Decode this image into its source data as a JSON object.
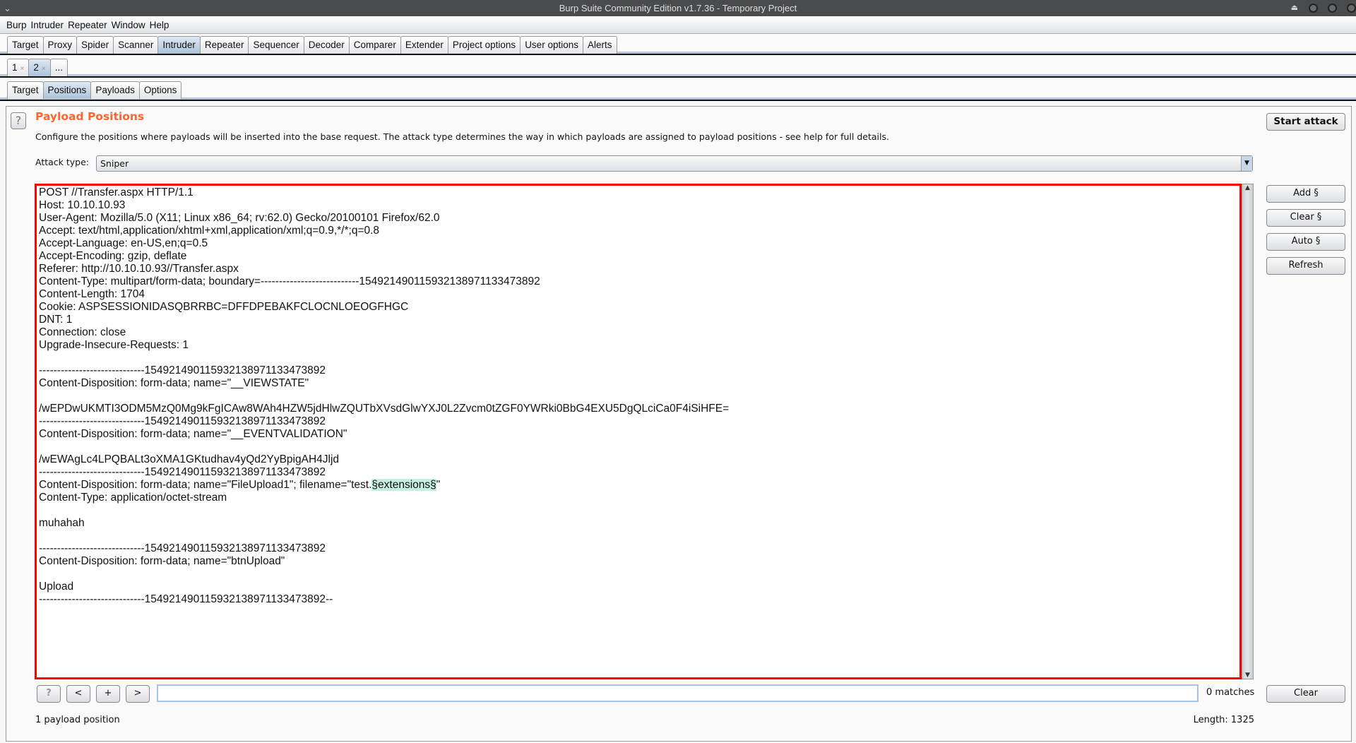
{
  "window": {
    "title": "Burp Suite Community Edition v1.7.36 - Temporary Project"
  },
  "menu": [
    "Burp",
    "Intruder",
    "Repeater",
    "Window",
    "Help"
  ],
  "main_tabs": [
    "Target",
    "Proxy",
    "Spider",
    "Scanner",
    "Intruder",
    "Repeater",
    "Sequencer",
    "Decoder",
    "Comparer",
    "Extender",
    "Project options",
    "User options",
    "Alerts"
  ],
  "main_tab_selected": "Intruder",
  "attack_tabs": [
    {
      "label": "1",
      "close": "×"
    },
    {
      "label": "2",
      "close": "×"
    },
    {
      "label": "...",
      "close": ""
    }
  ],
  "attack_tab_selected": "2",
  "sub_tabs": [
    "Target",
    "Positions",
    "Payloads",
    "Options"
  ],
  "sub_tab_selected": "Positions",
  "panel": {
    "help": "?",
    "title": "Payload Positions",
    "description": "Configure the positions where payloads will be inserted into the base request. The attack type determines the way in which payloads are assigned to payload positions - see help for full details.",
    "attack_type_label": "Attack type:",
    "attack_type_value": "Sniper",
    "start_attack": "Start attack",
    "side_buttons": [
      "Add §",
      "Clear §",
      "Auto §",
      "Refresh"
    ],
    "title_color": "#ff6633",
    "marker_color": "#c6efe4"
  },
  "request_lines": [
    {
      "text": "POST //Transfer.aspx HTTP/1.1"
    },
    {
      "text": "Host: 10.10.10.93"
    },
    {
      "text": "User-Agent: Mozilla/5.0 (X11; Linux x86_64; rv:62.0) Gecko/20100101 Firefox/62.0"
    },
    {
      "text": "Accept: text/html,application/xhtml+xml,application/xml;q=0.9,*/*;q=0.8"
    },
    {
      "text": "Accept-Language: en-US,en;q=0.5"
    },
    {
      "text": "Accept-Encoding: gzip, deflate"
    },
    {
      "text": "Referer: http://10.10.10.93//Transfer.aspx"
    },
    {
      "text": "Content-Type: multipart/form-data; boundary=---------------------------154921490115932138971133473892"
    },
    {
      "text": "Content-Length: 1704"
    },
    {
      "text": "Cookie: ASPSESSIONIDASQBRRBC=DFFDPEBAKFCLOCNLOEOGFHGC"
    },
    {
      "text": "DNT: 1"
    },
    {
      "text": "Connection: close"
    },
    {
      "text": "Upgrade-Insecure-Requests: 1"
    },
    {
      "text": ""
    },
    {
      "text": "-----------------------------154921490115932138971133473892"
    },
    {
      "text": "Content-Disposition: form-data; name=\"__VIEWSTATE\""
    },
    {
      "text": ""
    },
    {
      "text": "/wEPDwUKMTI3ODM5MzQ0Mg9kFgICAw8WAh4HZW5jdHlwZQUTbXVsdGlwYXJ0L2Zvcm0tZGF0YWRki0BbG4EXU5DgQLciCa0F4iSiHFE="
    },
    {
      "text": "-----------------------------154921490115932138971133473892"
    },
    {
      "text": "Content-Disposition: form-data; name=\"__EVENTVALIDATION\""
    },
    {
      "text": ""
    },
    {
      "text": "/wEWAgLc4LPQBALt3oXMA1GKtudhav4yQd2YyBpigAH4Jljd"
    },
    {
      "text": "-----------------------------154921490115932138971133473892"
    },
    {
      "pre": "Content-Disposition: form-data; name=\"FileUpload1\"; filename=\"test.",
      "mark": "§extensions§",
      "post": "\""
    },
    {
      "text": "Content-Type: application/octet-stream"
    },
    {
      "text": ""
    },
    {
      "text": "muhahah"
    },
    {
      "text": ""
    },
    {
      "text": "-----------------------------154921490115932138971133473892"
    },
    {
      "text": "Content-Disposition: form-data; name=\"btnUpload\""
    },
    {
      "text": ""
    },
    {
      "text": "Upload"
    },
    {
      "text": "-----------------------------154921490115932138971133473892--"
    }
  ],
  "search": {
    "help": "?",
    "prev": "<",
    "add": "+",
    "next": ">",
    "value": "",
    "matches": "0 matches",
    "clear": "Clear"
  },
  "status": {
    "positions": "1 payload position",
    "length": "Length: 1325"
  }
}
